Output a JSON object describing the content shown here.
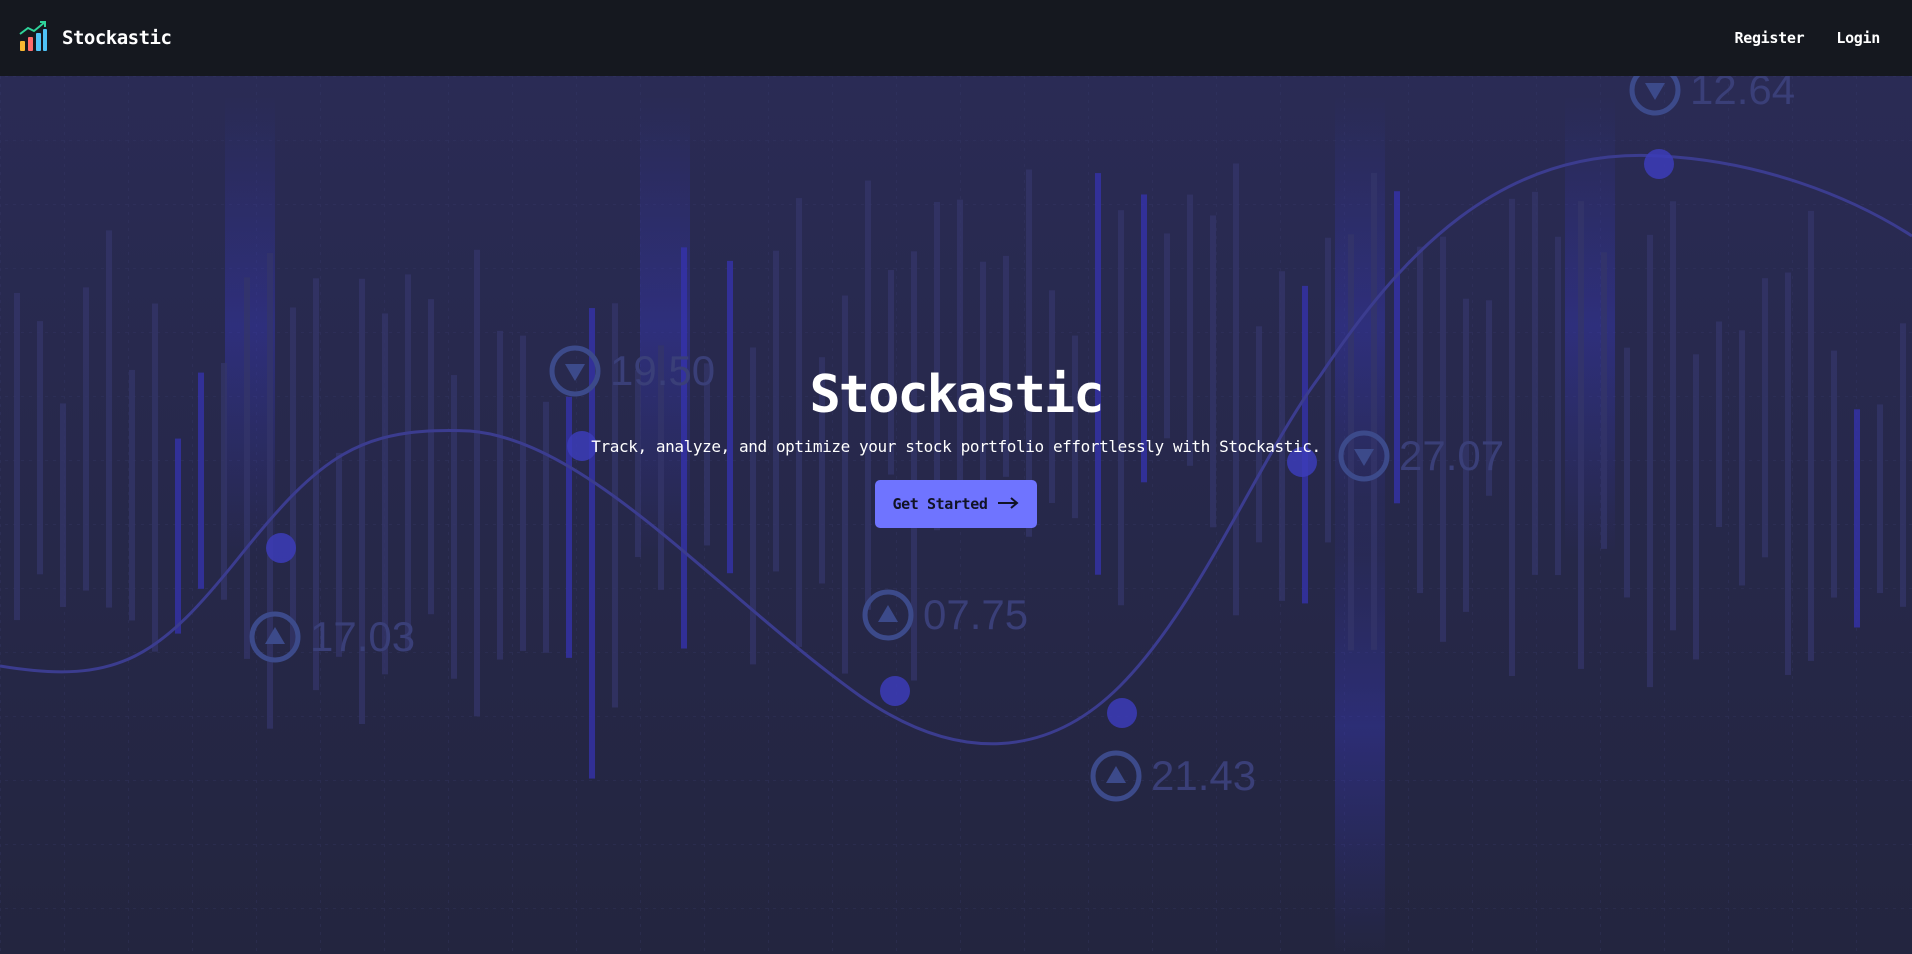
{
  "navbar": {
    "brand_name": "Stockastic",
    "links": [
      {
        "label": "Register"
      },
      {
        "label": "Login"
      }
    ]
  },
  "hero": {
    "title": "Stockastic",
    "subtitle": "Track, analyze, and optimize your stock portfolio effortlessly with Stockastic.",
    "cta_label": "Get Started",
    "cta_icon": "arrow-right-icon"
  },
  "background": {
    "tickers": [
      {
        "value": "17.03",
        "direction": "up"
      },
      {
        "value": "19.50",
        "direction": "down"
      },
      {
        "value": "07.75",
        "direction": "up"
      },
      {
        "value": "21.43",
        "direction": "up"
      },
      {
        "value": "27.07",
        "direction": "down"
      },
      {
        "value": "12.64",
        "direction": "down"
      }
    ]
  },
  "colors": {
    "navbar_bg": "#15181f",
    "hero_bg": "#25264a",
    "accent": "#6f74ff",
    "text": "#ffffff"
  }
}
